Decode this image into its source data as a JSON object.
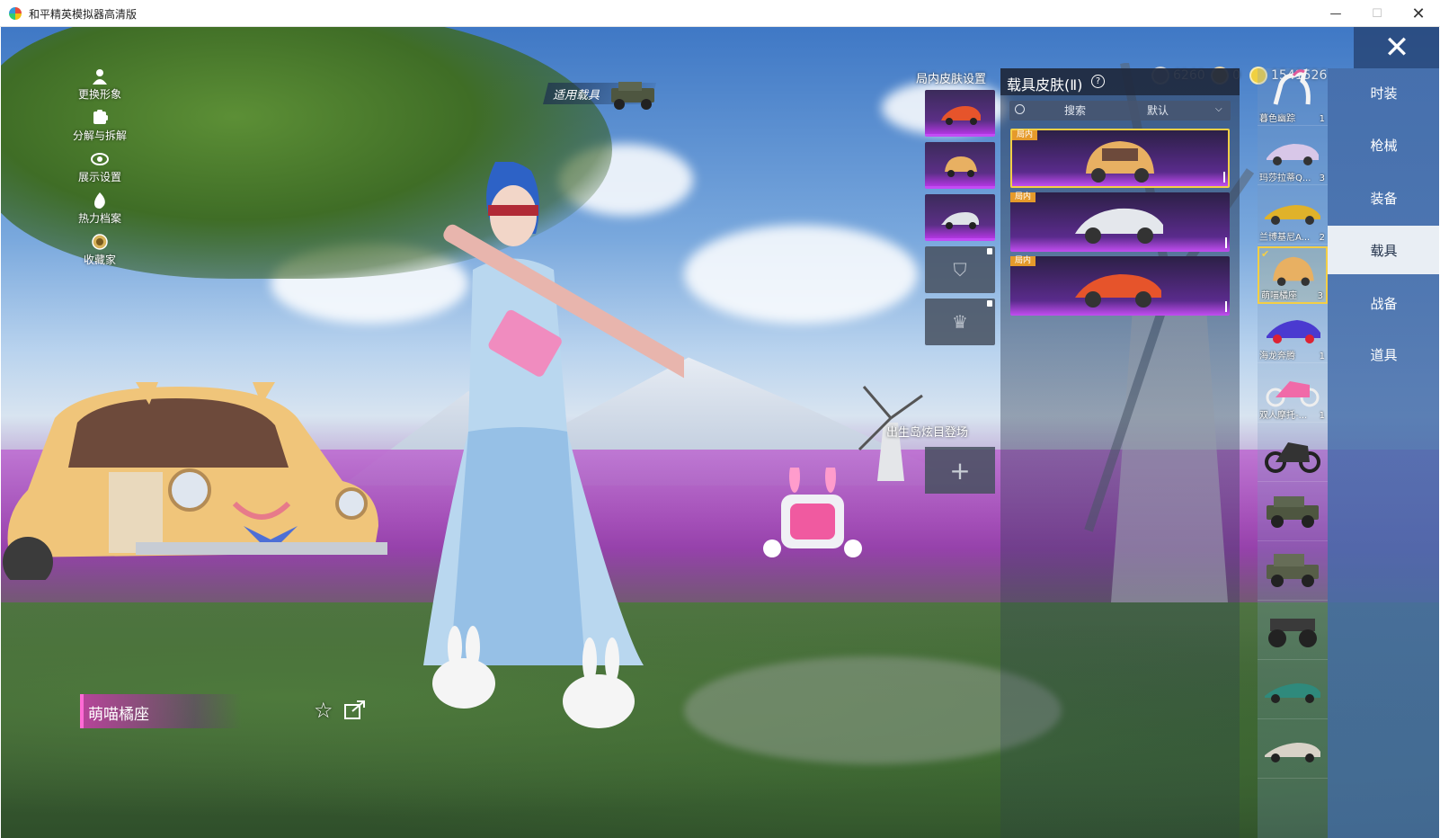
{
  "window": {
    "title": "和平精英模拟器高清版",
    "minimize_glyph": "—",
    "maximize_glyph": "☐",
    "close_glyph": "✕"
  },
  "left_menu": [
    {
      "label": "更换形象",
      "icon": "person-icon"
    },
    {
      "label": "分解与拆解",
      "icon": "puzzle-icon"
    },
    {
      "label": "展示设置",
      "icon": "eye-icon"
    },
    {
      "label": "热力档案",
      "icon": "flame-icon"
    },
    {
      "label": "收藏家",
      "icon": "badge-icon"
    }
  ],
  "apply_vehicle": {
    "label": "适用载具"
  },
  "currency": [
    {
      "value": "6260",
      "icon": "token-icon",
      "color": "#b9c6d6"
    },
    {
      "value": "0",
      "icon": "gold-token-icon",
      "color": "#e0b53c"
    },
    {
      "value": "1541526",
      "icon": "coin-icon",
      "color": "#f0d040"
    }
  ],
  "close_game_glyph": "✕",
  "skin_settings": {
    "title": "局内皮肤设置",
    "spawn_title": "出生岛炫目登场",
    "add_glyph": "+"
  },
  "panel": {
    "title": "载具皮肤(Ⅱ)",
    "help_glyph": "?",
    "search_placeholder": "搜索",
    "sort_label": "默认",
    "sort_chevron": "⌵"
  },
  "skin_cards": [
    {
      "badge": "局内",
      "selected": true
    },
    {
      "badge": "局内",
      "selected": false
    },
    {
      "badge": "局内",
      "selected": false
    }
  ],
  "vehicles": [
    {
      "name": "暮色幽踪",
      "count": "1"
    },
    {
      "name": "玛莎拉蒂Q...",
      "count": "3"
    },
    {
      "name": "兰博基尼A...",
      "count": "2"
    },
    {
      "name": "萌喵橘座",
      "count": "3",
      "selected": true
    },
    {
      "name": "海龙奔腾",
      "count": "1"
    },
    {
      "name": "双人摩托-...",
      "count": "1"
    },
    {
      "name": "",
      "count": ""
    },
    {
      "name": "",
      "count": ""
    },
    {
      "name": "",
      "count": ""
    },
    {
      "name": "",
      "count": ""
    },
    {
      "name": "",
      "count": ""
    },
    {
      "name": "",
      "count": ""
    }
  ],
  "categories": [
    {
      "label": "时装",
      "active": false
    },
    {
      "label": "枪械",
      "active": false
    },
    {
      "label": "装备",
      "active": false
    },
    {
      "label": "载具",
      "active": true
    },
    {
      "label": "战备",
      "active": false
    },
    {
      "label": "道具",
      "active": false
    }
  ],
  "current_skin": {
    "name": "萌喵橘座"
  },
  "colors": {
    "accent_gold": "#f4cf45",
    "purple": "#c24df0",
    "tab_blue": "#466eaa"
  }
}
